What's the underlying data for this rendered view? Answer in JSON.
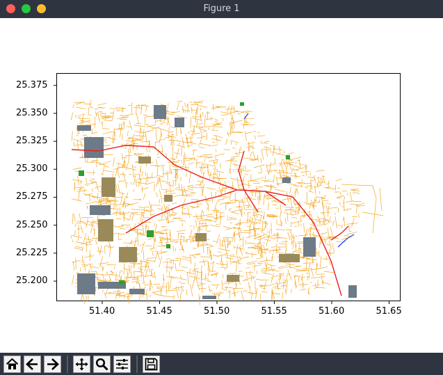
{
  "window": {
    "title": "Figure 1",
    "controls": {
      "close_color": "#fe5f57",
      "minimize_color": "#28c840",
      "zoom_color": "#febc2e"
    }
  },
  "chart_data": {
    "type": "map",
    "title": "",
    "xlabel": "",
    "ylabel": "",
    "xlim": [
      51.36,
      51.66
    ],
    "ylim": [
      25.182,
      25.386
    ],
    "x_ticks": [
      51.4,
      51.45,
      51.5,
      51.55,
      51.6,
      51.65
    ],
    "x_tick_labels": [
      "51.40",
      "51.45",
      "51.50",
      "51.55",
      "51.60",
      "51.65"
    ],
    "y_ticks": [
      25.2,
      25.225,
      25.25,
      25.275,
      25.3,
      25.325,
      25.35,
      25.375
    ],
    "y_tick_labels": [
      "25.200",
      "25.225",
      "25.250",
      "25.275",
      "25.300",
      "25.325",
      "25.350",
      "25.375"
    ],
    "layers": [
      {
        "name": "roads",
        "color": "#f5a623"
      },
      {
        "name": "primary roads",
        "color": "#e8201c"
      },
      {
        "name": "buildings",
        "color": "#6d7a88"
      },
      {
        "name": "built areas",
        "color": "#9a8a5a"
      },
      {
        "name": "parks",
        "color": "#2e9e2e"
      },
      {
        "name": "water",
        "color": "#1f3cff"
      }
    ],
    "grid": false
  },
  "toolbar": {
    "buttons": [
      {
        "name": "home-button",
        "icon": "home-icon",
        "tooltip": "Reset original view"
      },
      {
        "name": "back-button",
        "icon": "arrow-left-icon",
        "tooltip": "Back"
      },
      {
        "name": "forward-button",
        "icon": "arrow-right-icon",
        "tooltip": "Forward"
      },
      {
        "name": "pan-button",
        "icon": "move-icon",
        "tooltip": "Pan"
      },
      {
        "name": "zoom-button",
        "icon": "magnifier-icon",
        "tooltip": "Zoom"
      },
      {
        "name": "configure-button",
        "icon": "sliders-icon",
        "tooltip": "Configure subplots"
      },
      {
        "name": "save-button",
        "icon": "floppy-disk-icon",
        "tooltip": "Save"
      }
    ]
  }
}
